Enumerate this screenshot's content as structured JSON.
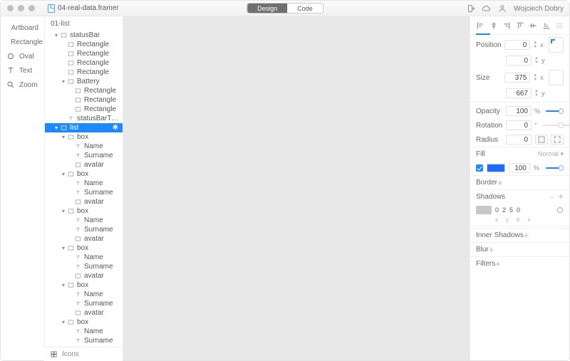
{
  "titlebar": {
    "filename": "04-real-data.framer",
    "modes": {
      "design": "Design",
      "code": "Code",
      "active": "design"
    },
    "username": "Wojciech Dobry"
  },
  "toolrail": {
    "artboard": "Artboard",
    "rectangle": "Rectangle",
    "oval": "Oval",
    "text": "Text",
    "zoom": "Zoom",
    "icons": "Icons"
  },
  "layers": {
    "root": "01-list",
    "items": [
      {
        "d": 1,
        "k": "rect",
        "c": "v",
        "t": "statusBar"
      },
      {
        "d": 2,
        "k": "rect",
        "c": "",
        "t": "Rectangle"
      },
      {
        "d": 2,
        "k": "rect",
        "c": "",
        "t": "Rectangle"
      },
      {
        "d": 2,
        "k": "rect",
        "c": "",
        "t": "Rectangle"
      },
      {
        "d": 2,
        "k": "rect",
        "c": "",
        "t": "Rectangle"
      },
      {
        "d": 2,
        "k": "rect",
        "c": "v",
        "t": "Battery"
      },
      {
        "d": 3,
        "k": "rect",
        "c": "",
        "t": "Rectangle"
      },
      {
        "d": 3,
        "k": "rect",
        "c": "",
        "t": "Rectangle"
      },
      {
        "d": 3,
        "k": "rect",
        "c": "",
        "t": "Rectangle"
      },
      {
        "d": 2,
        "k": "text",
        "c": "",
        "t": "statusBarTime"
      },
      {
        "d": 1,
        "k": "rect",
        "c": "v",
        "t": "list",
        "sel": true
      },
      {
        "d": 2,
        "k": "rect",
        "c": "v",
        "t": "box"
      },
      {
        "d": 3,
        "k": "text",
        "c": "",
        "t": "Name"
      },
      {
        "d": 3,
        "k": "text",
        "c": "",
        "t": "Surname"
      },
      {
        "d": 3,
        "k": "rect",
        "c": "",
        "t": "avatar"
      },
      {
        "d": 2,
        "k": "rect",
        "c": "v",
        "t": "box"
      },
      {
        "d": 3,
        "k": "text",
        "c": "",
        "t": "Name"
      },
      {
        "d": 3,
        "k": "text",
        "c": "",
        "t": "Surname"
      },
      {
        "d": 3,
        "k": "rect",
        "c": "",
        "t": "avatar"
      },
      {
        "d": 2,
        "k": "rect",
        "c": "v",
        "t": "box"
      },
      {
        "d": 3,
        "k": "text",
        "c": "",
        "t": "Name"
      },
      {
        "d": 3,
        "k": "text",
        "c": "",
        "t": "Surname"
      },
      {
        "d": 3,
        "k": "rect",
        "c": "",
        "t": "avatar"
      },
      {
        "d": 2,
        "k": "rect",
        "c": "v",
        "t": "box"
      },
      {
        "d": 3,
        "k": "text",
        "c": "",
        "t": "Name"
      },
      {
        "d": 3,
        "k": "text",
        "c": "",
        "t": "Surname"
      },
      {
        "d": 3,
        "k": "rect",
        "c": "",
        "t": "avatar"
      },
      {
        "d": 2,
        "k": "rect",
        "c": "v",
        "t": "box"
      },
      {
        "d": 3,
        "k": "text",
        "c": "",
        "t": "Name"
      },
      {
        "d": 3,
        "k": "text",
        "c": "",
        "t": "Surname"
      },
      {
        "d": 3,
        "k": "rect",
        "c": "",
        "t": "avatar"
      },
      {
        "d": 2,
        "k": "rect",
        "c": "v",
        "t": "box"
      },
      {
        "d": 3,
        "k": "text",
        "c": "",
        "t": "Name"
      },
      {
        "d": 3,
        "k": "text",
        "c": "",
        "t": "Surname"
      }
    ]
  },
  "inspector": {
    "position": {
      "label": "Position",
      "x": "0",
      "y": "0"
    },
    "size": {
      "label": "Size",
      "w": "375",
      "h": "667"
    },
    "opacity": {
      "label": "Opacity",
      "value": "100"
    },
    "rotation": {
      "label": "Rotation",
      "value": "0"
    },
    "radius": {
      "label": "Radius",
      "value": "0"
    },
    "fill": {
      "label": "Fill",
      "mode": "Normal",
      "value": "100",
      "pct": "%"
    },
    "border": {
      "label": "Border"
    },
    "shadows": {
      "label": "Shadows",
      "x": "0",
      "y": "2",
      "b": "5",
      "s": "0",
      "axislabels": {
        "x": "x",
        "y": "y",
        "b": "b",
        "s": "s"
      }
    },
    "inner": {
      "label": "Inner Shadows"
    },
    "blur": {
      "label": "Blur"
    },
    "filters": {
      "label": "Filters"
    },
    "axis": {
      "x": "x",
      "y": "y"
    }
  }
}
